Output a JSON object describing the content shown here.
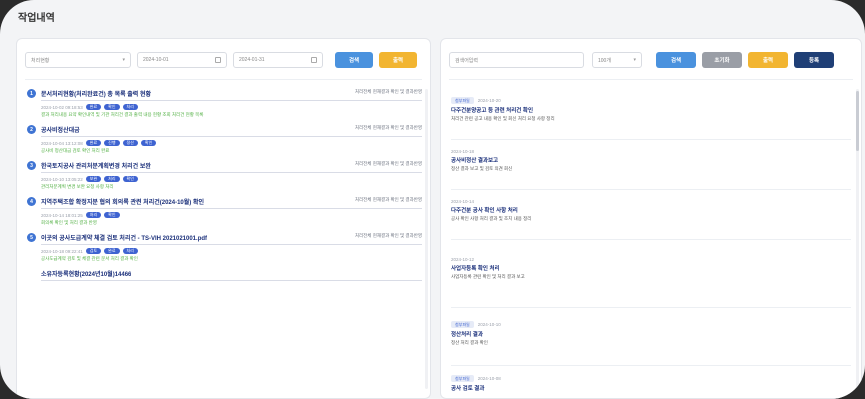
{
  "page": {
    "title": "작업내역"
  },
  "left": {
    "filters": {
      "select1": "처리현황",
      "date_from": "2024-10-01",
      "date_to": "2024-01-31",
      "search_btn": "검색",
      "excel_btn": "출력"
    },
    "items": [
      {
        "num": "1",
        "title": "문서처리현황(처리완료건) 총 목록 출력 현황",
        "side": "처리전체 현재결과 확인 및 결과반영",
        "date": "2024-10-02 09:18:53",
        "tags": [
          "완료",
          "확인",
          "처리"
        ],
        "desc": "결과 처리내용 요약 확인내역 및 기관 처리건 결과 출력 내용 현황 조회 처리건 현황 목록"
      },
      {
        "num": "2",
        "title": "공사비정산대금",
        "side": "처리전체 현재결과 확인 및 결과반영",
        "date": "2024-10-04 13:12:08",
        "tags": [
          "완료",
          "진행",
          "정산",
          "확인"
        ],
        "desc": "공사비 정산대금 검토 확인 처리 완료"
      },
      {
        "num": "3",
        "title": "한국토지공사 관리처분계획변경 처리건 보완",
        "side": "처리전체 현재결과 확인 및 결과반영",
        "date": "2024-10-10 13:05:22",
        "tags": [
          "보완",
          "처리",
          "확인"
        ],
        "desc": "관리처분계획 변경 보완 요청 사항 처리"
      },
      {
        "num": "4",
        "title": "지역주택조합 확정지분 협의 회의록 관련 처리건(2024-10월) 확인",
        "side": "처리전체 현재결과 확인 및 결과반영",
        "date": "2024-10-14 18:01:25",
        "tags": [
          "처리",
          "확인"
        ],
        "desc": "회의록 확인 및 처리 결과 반영"
      },
      {
        "num": "5",
        "title": "이곳의 공사도급계약 체결 검토 처리건 - TS-VIH 2021021001.pdf",
        "side": "처리전체 현재결과 확인 및 결과반영",
        "date": "2024-10-18 09:22:41",
        "tags": [
          "검토",
          "완료",
          "처리"
        ],
        "desc": "공사도급계약 검토 및 체결 관련 문서 처리 결과 확인"
      }
    ],
    "next_title": "소유자등록현황(2024년10월)14466"
  },
  "right": {
    "filters": {
      "search_placeholder": "검색어입력",
      "select": "100개",
      "search_btn": "검색",
      "reset_btn": "초기화",
      "excel_btn": "출력",
      "add_btn": "등록"
    },
    "items": [
      {
        "badge": "첨부파일",
        "date": "2024-10-20",
        "title": "다주건분양공고 등 관련 처리건 확인",
        "body": "처리건 관련 공고 내용 확인 및 회신 처리 요청 사항 정리"
      },
      {
        "badge": "",
        "date": "2024-10-18",
        "title": "공사비정산 결과보고",
        "body": "정산 결과 보고 및 검토 의견 회신"
      },
      {
        "badge": "",
        "date": "2024-10-14",
        "title": "다주건분 공사 확인 사항 처리",
        "body": "공사 확인 사항 처리 결과 및 조치 내용 정리"
      },
      {
        "badge": "",
        "date": "2024-10-12",
        "title": "사업자등록 확인 처리",
        "body": "사업자등록 관련 확인 및 처리 결과 보고"
      },
      {
        "badge": "첨부파일",
        "date": "2024-10-10",
        "title": "정산처리 결과",
        "body": "정산 처리 결과 확인"
      },
      {
        "badge": "첨부파일",
        "date": "2024-10-08",
        "title": "공사 검토 결과",
        "body": ""
      }
    ]
  }
}
